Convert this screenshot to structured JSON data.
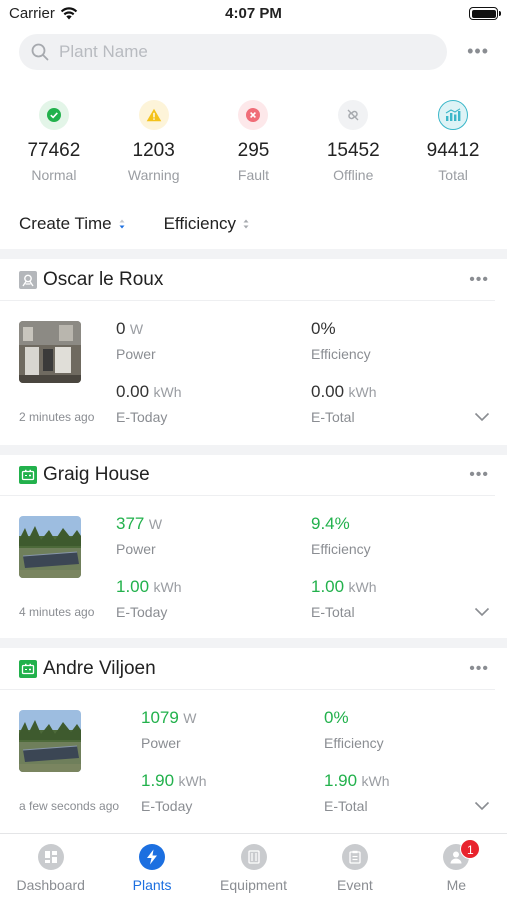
{
  "status_bar": {
    "carrier": "Carrier",
    "time": "4:07 PM"
  },
  "search": {
    "placeholder": "Plant Name"
  },
  "stats": [
    {
      "value": "77462",
      "label": "Normal",
      "icon": "check-icon",
      "color": "#22b14c"
    },
    {
      "value": "1203",
      "label": "Warning",
      "icon": "warning-icon",
      "color": "#f4c21a"
    },
    {
      "value": "295",
      "label": "Fault",
      "icon": "fault-icon",
      "color": "#f06d78"
    },
    {
      "value": "15452",
      "label": "Offline",
      "icon": "offline-icon",
      "color": "#b8bbc0"
    },
    {
      "value": "94412",
      "label": "Total",
      "icon": "total-chart-icon",
      "color": "#3bb7c9"
    }
  ],
  "sort": {
    "create_time": "Create Time",
    "efficiency": "Efficiency"
  },
  "plants": [
    {
      "name": "Oscar le Roux",
      "status_icon": "offline-plant-icon",
      "updated": "2 minutes ago",
      "power": "0",
      "power_unit": "W",
      "power_label": "Power",
      "efficiency": "0%",
      "efficiency_label": "Efficiency",
      "e_today": "0.00",
      "e_today_unit": "kWh",
      "e_today_label": "E-Today",
      "e_total": "0.00",
      "e_total_unit": "kWh",
      "e_total_label": "E-Total"
    },
    {
      "name": "Graig House",
      "status_icon": "online-battery-icon",
      "updated": "4 minutes ago",
      "power": "377",
      "power_unit": "W",
      "power_label": "Power",
      "efficiency": "9.4%",
      "efficiency_label": "Efficiency",
      "e_today": "1.00",
      "e_today_unit": "kWh",
      "e_today_label": "E-Today",
      "e_total": "1.00",
      "e_total_unit": "kWh",
      "e_total_label": "E-Total"
    },
    {
      "name": "Andre Viljoen",
      "status_icon": "online-battery-icon",
      "updated": "a few seconds ago",
      "power": "1079",
      "power_unit": "W",
      "power_label": "Power",
      "efficiency": "0%",
      "efficiency_label": "Efficiency",
      "e_today": "1.90",
      "e_today_unit": "kWh",
      "e_today_label": "E-Today",
      "e_total": "1.90",
      "e_total_unit": "kWh",
      "e_total_label": "E-Total"
    }
  ],
  "tabs": [
    {
      "label": "Dashboard",
      "icon": "dashboard-icon"
    },
    {
      "label": "Plants",
      "icon": "plants-bolt-icon"
    },
    {
      "label": "Equipment",
      "icon": "equipment-icon"
    },
    {
      "label": "Event",
      "icon": "event-icon"
    },
    {
      "label": "Me",
      "icon": "me-icon",
      "badge": "1"
    }
  ],
  "colors": {
    "accent": "#1c6fe0",
    "green": "#22b14c",
    "badge_red": "#e8232d"
  }
}
